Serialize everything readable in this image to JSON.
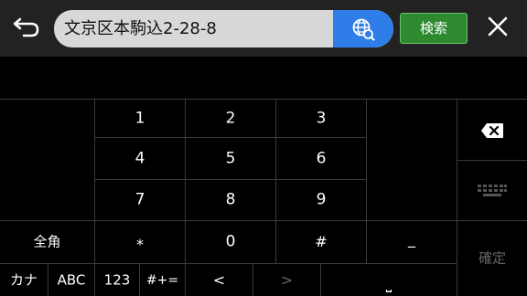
{
  "header": {
    "search_value": "文京区本駒込2-28-8",
    "search_button_label": "検索"
  },
  "keypad": {
    "rows": [
      [
        "1",
        "2",
        "3"
      ],
      [
        "4",
        "5",
        "6"
      ],
      [
        "7",
        "8",
        "9"
      ],
      [
        "*",
        "0",
        "#"
      ]
    ],
    "dash_key": "_",
    "zenkaku_key": "全角",
    "confirm_key": "確定"
  },
  "mode_row": {
    "kana": "カナ",
    "abc": "ABC",
    "num": "123",
    "symbols": "#+=",
    "left_arrow": "<",
    "right_arrow": ">",
    "space": "⎵"
  },
  "colors": {
    "topbar": "#222222",
    "search_field": "#d8d8d8",
    "globe_button": "#2f7de8",
    "search_button": "#2e8a2e",
    "key_border": "#3a3a3a",
    "disabled_text": "#666666"
  }
}
